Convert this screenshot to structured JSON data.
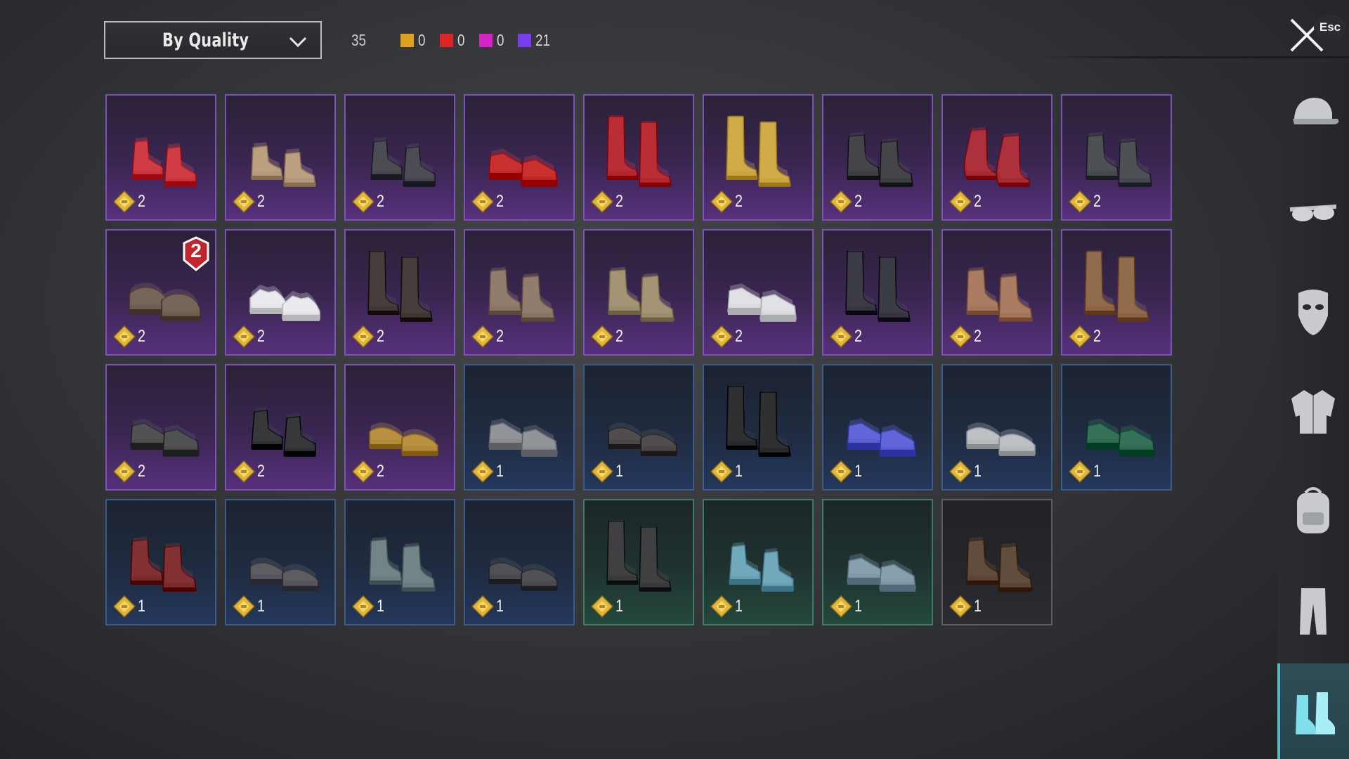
{
  "header": {
    "sort_label": "By Quality",
    "total": "35",
    "tiers": [
      {
        "color": "#e0a21e",
        "count": "0"
      },
      {
        "color": "#e02424",
        "count": "0"
      },
      {
        "color": "#d623c8",
        "count": "0"
      },
      {
        "color": "#7a3df0",
        "count": "21"
      }
    ]
  },
  "close": {
    "esc_label": "Esc"
  },
  "items": [
    {
      "quality": "purple",
      "value": "2",
      "color": "#c8353d",
      "style": "sneaker-high"
    },
    {
      "quality": "purple",
      "value": "2",
      "color": "#b49a7a",
      "style": "boot-short"
    },
    {
      "quality": "purple",
      "value": "2",
      "color": "#44464c",
      "style": "sneaker-high"
    },
    {
      "quality": "purple",
      "value": "2",
      "color": "#c22a2a",
      "style": "sneaker"
    },
    {
      "quality": "purple",
      "value": "2",
      "color": "#b3262e",
      "style": "boot-tall"
    },
    {
      "quality": "purple",
      "value": "2",
      "color": "#c9a441",
      "style": "boot-tall"
    },
    {
      "quality": "purple",
      "value": "2",
      "color": "#3d3e40",
      "style": "boot"
    },
    {
      "quality": "purple",
      "value": "2",
      "color": "#a52a34",
      "style": "boot-curl"
    },
    {
      "quality": "purple",
      "value": "2",
      "color": "#46484d",
      "style": "boot"
    },
    {
      "quality": "purple",
      "value": "2",
      "color": "#6f5c52",
      "style": "slipper",
      "badge": "2"
    },
    {
      "quality": "purple",
      "value": "2",
      "color": "#e2e4e8",
      "style": "sandal"
    },
    {
      "quality": "purple",
      "value": "2",
      "color": "#3e3733",
      "style": "boot-tall"
    },
    {
      "quality": "purple",
      "value": "2",
      "color": "#8a7466",
      "style": "boot"
    },
    {
      "quality": "purple",
      "value": "2",
      "color": "#9c8c6e",
      "style": "boot"
    },
    {
      "quality": "purple",
      "value": "2",
      "color": "#d9dadd",
      "style": "sneaker"
    },
    {
      "quality": "purple",
      "value": "2",
      "color": "#35343f",
      "style": "boot-tall"
    },
    {
      "quality": "purple",
      "value": "2",
      "color": "#a3755a",
      "style": "boot"
    },
    {
      "quality": "purple",
      "value": "2",
      "color": "#8a6444",
      "style": "boot-tall"
    },
    {
      "quality": "purple",
      "value": "2",
      "color": "#4a4b4d",
      "style": "sneaker"
    },
    {
      "quality": "purple",
      "value": "2",
      "color": "#2f3032",
      "style": "sneaker-high"
    },
    {
      "quality": "purple",
      "value": "2",
      "color": "#b08a3a",
      "style": "loafer"
    },
    {
      "quality": "blue",
      "value": "1",
      "color": "#8a8c92",
      "style": "sneaker"
    },
    {
      "quality": "blue",
      "value": "1",
      "color": "#4a4446",
      "style": "loafer"
    },
    {
      "quality": "blue",
      "value": "1",
      "color": "#27282b",
      "style": "boot-tall"
    },
    {
      "quality": "blue",
      "value": "1",
      "color": "#5a5fd0",
      "style": "sneaker"
    },
    {
      "quality": "blue",
      "value": "1",
      "color": "#b7babd",
      "style": "loafer"
    },
    {
      "quality": "blue",
      "value": "1",
      "color": "#2e6a52",
      "style": "sneaker"
    },
    {
      "quality": "blue",
      "value": "1",
      "color": "#7a2a2a",
      "style": "boot"
    },
    {
      "quality": "blue",
      "value": "1",
      "color": "#54545a",
      "style": "loafer"
    },
    {
      "quality": "blue",
      "value": "1",
      "color": "#6b7d7e",
      "style": "boot"
    },
    {
      "quality": "blue",
      "value": "1",
      "color": "#4a4a4e",
      "style": "loafer"
    },
    {
      "quality": "green",
      "value": "1",
      "color": "#38393b",
      "style": "boot-tall"
    },
    {
      "quality": "green",
      "value": "1",
      "color": "#6aa0b4",
      "style": "sneaker-high"
    },
    {
      "quality": "green",
      "value": "1",
      "color": "#7f98a8",
      "style": "sneaker"
    },
    {
      "quality": "gray",
      "value": "1",
      "color": "#5b4434",
      "style": "boot"
    }
  ],
  "sidebar": [
    {
      "icon": "cap-icon"
    },
    {
      "icon": "sunglasses-icon"
    },
    {
      "icon": "mask-icon"
    },
    {
      "icon": "jacket-icon"
    },
    {
      "icon": "backpack-icon"
    },
    {
      "icon": "pants-icon"
    },
    {
      "icon": "shoes-icon",
      "active": true
    }
  ]
}
